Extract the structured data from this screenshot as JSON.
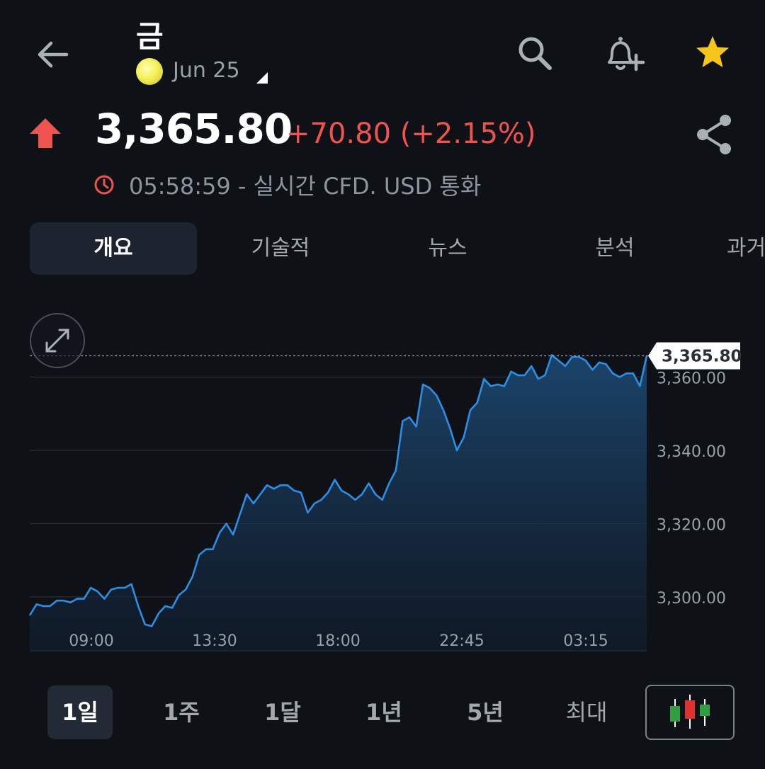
{
  "header": {
    "title": "금",
    "contract": "Jun 25",
    "icons": [
      "back-arrow-icon",
      "search-icon",
      "add-alert-icon",
      "star-icon"
    ]
  },
  "quote": {
    "price": "3,365.80",
    "change": "+70.80 (+2.15%)",
    "timestamp": "05:58:59 - 실시간 CFD. USD 통화",
    "direction": "up",
    "up_color": "#ef5350"
  },
  "tabs": [
    {
      "label": "개요",
      "active": true
    },
    {
      "label": "기술적",
      "active": false
    },
    {
      "label": "뉴스",
      "active": false
    },
    {
      "label": "분석",
      "active": false
    },
    {
      "label": "과거",
      "active": false
    }
  ],
  "ranges": [
    {
      "label": "1일",
      "active": true
    },
    {
      "label": "1주",
      "active": false
    },
    {
      "label": "1달",
      "active": false
    },
    {
      "label": "1년",
      "active": false
    },
    {
      "label": "5년",
      "active": false
    },
    {
      "label": "최대",
      "active": false
    }
  ],
  "chart_data": {
    "type": "area",
    "y_ticks": [
      3300,
      3320,
      3340,
      3360
    ],
    "y_tick_labels": [
      "3,300.00",
      "3,320.00",
      "3,340.00",
      "3,360.00"
    ],
    "x_tick_labels": [
      "09:00",
      "13:30",
      "18:00",
      "22:45",
      "03:15"
    ],
    "ylim": [
      3291,
      3370
    ],
    "last_price_label": "3,365.80",
    "last_price": 3365.8,
    "line_color": "#2b8fe6",
    "grid": true,
    "series": [
      {
        "values": [
          3295,
          3298,
          3297.5,
          3297.5,
          3299,
          3299,
          3298.5,
          3299.5,
          3299.5,
          3302.5,
          3301.5,
          3299.5,
          3302,
          3302.5,
          3302.5,
          3303.5,
          3297.5,
          3292.5,
          3292,
          3295.5,
          3297.5,
          3297,
          3300.5,
          3302,
          3305.5,
          3311.5,
          3313,
          3313,
          3317.5,
          3320,
          3317,
          3322.5,
          3328,
          3325.5,
          3328,
          3330.5,
          3329.5,
          3330.5,
          3330.5,
          3329,
          3328.5,
          3323,
          3325.5,
          3326.5,
          3328.5,
          3332,
          3329,
          3328,
          3326.5,
          3328,
          3331,
          3328,
          3326.5,
          3331,
          3334.5,
          3348,
          3349,
          3346.5,
          3358,
          3357,
          3355,
          3351,
          3346,
          3340,
          3343.5,
          3351,
          3353,
          3359.5,
          3357.5,
          3358,
          3357.5,
          3361.5,
          3360.5,
          3360.5,
          3363,
          3359.5,
          3360.5,
          3366,
          3364.5,
          3363,
          3365.5,
          3365.5,
          3364.5,
          3362,
          3364,
          3363.5,
          3361,
          3360,
          3361,
          3361,
          3357.5,
          3365.8
        ]
      }
    ]
  }
}
